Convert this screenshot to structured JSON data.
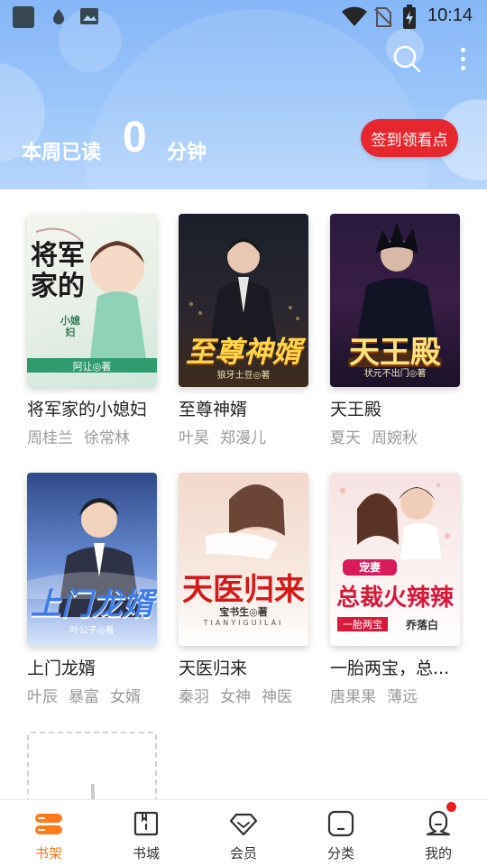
{
  "status_bar": {
    "time": "10:14",
    "icons": [
      "app-square-icon",
      "droplet-icon",
      "image-icon",
      "wifi-icon",
      "no-sim-icon",
      "battery-charging-icon"
    ]
  },
  "header": {
    "weekly_prefix": "本周已读",
    "weekly_count": "0",
    "weekly_unit": "分钟",
    "signin_label": "签到领看点",
    "icons": [
      "search-icon",
      "more-vert-icon"
    ]
  },
  "books": [
    {
      "title": "将军家的小媳妇",
      "tags": [
        "周桂兰",
        "徐常林"
      ],
      "cover_text": "将军家的",
      "cover_small": "小媳妇",
      "cover_author": "阿让◎著"
    },
    {
      "title": "至尊神婿",
      "tags": [
        "叶昊",
        "郑漫儿"
      ],
      "cover_text": "至尊神婿",
      "cover_author": "狼牙土豆◎著"
    },
    {
      "title": "天王殿",
      "tags": [
        "夏天",
        "周婉秋"
      ],
      "cover_text": "天王殿",
      "cover_author": "状元不出门◎著"
    },
    {
      "title": "上门龙婿",
      "tags": [
        "叶辰",
        "暴富",
        "女婿"
      ],
      "cover_text": "上门龙婿",
      "cover_author": "叶公子◎著"
    },
    {
      "title": "天医归来",
      "tags": [
        "秦羽",
        "女神",
        "神医"
      ],
      "cover_text": "天医归来",
      "cover_author": "宝书生◎著",
      "cover_sub": "TIANYIGUILAI"
    },
    {
      "title": "一胎两宝，总...",
      "tags": [
        "唐果果",
        "薄远"
      ],
      "cover_text": "总裁火辣辣",
      "cover_small": "宠妻",
      "cover_author": "乔落白",
      "cover_sub": "一胎两宝"
    }
  ],
  "bottom_nav": {
    "items": [
      {
        "label": "书架",
        "icon": "bookshelf-icon",
        "active": true
      },
      {
        "label": "书城",
        "icon": "bookstore-icon",
        "active": false
      },
      {
        "label": "会员",
        "icon": "diamond-icon",
        "active": false
      },
      {
        "label": "分类",
        "icon": "category-icon",
        "active": false
      },
      {
        "label": "我的",
        "icon": "profile-icon",
        "active": false,
        "badge": true
      }
    ]
  },
  "colors": {
    "header_top": "#86b6f7",
    "signin_red": "#e5282f",
    "active_orange": "#ff7a1a",
    "tag_gray": "#9a9a9a",
    "badge_red": "#f11d1d"
  }
}
